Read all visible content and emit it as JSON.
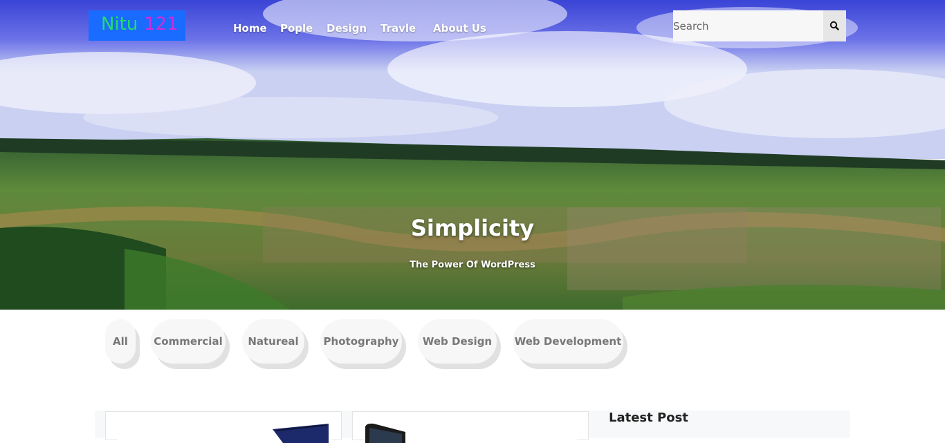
{
  "header": {
    "logo": {
      "part1": "Nitu",
      "part2": "121"
    },
    "nav": [
      "Home",
      "Pople",
      "Design",
      "Travle",
      "About Us"
    ],
    "search": {
      "placeholder": "Search",
      "icon": "search-icon"
    }
  },
  "hero": {
    "title": "Simplicity",
    "subtitle": "The Power Of WordPress"
  },
  "filters": [
    "All",
    "Commercial",
    "Natureal",
    "Photography",
    "Web Design",
    "Web Development"
  ],
  "sidebar": {
    "latest_post_title": "Latest Post"
  },
  "colors": {
    "logo_bg": "#1a6bff",
    "logo_text_1": "#23e062",
    "logo_text_2": "#d42bd8",
    "filter_bg": "#f7f7f7",
    "filter_shadow": "#e1e1e1"
  }
}
